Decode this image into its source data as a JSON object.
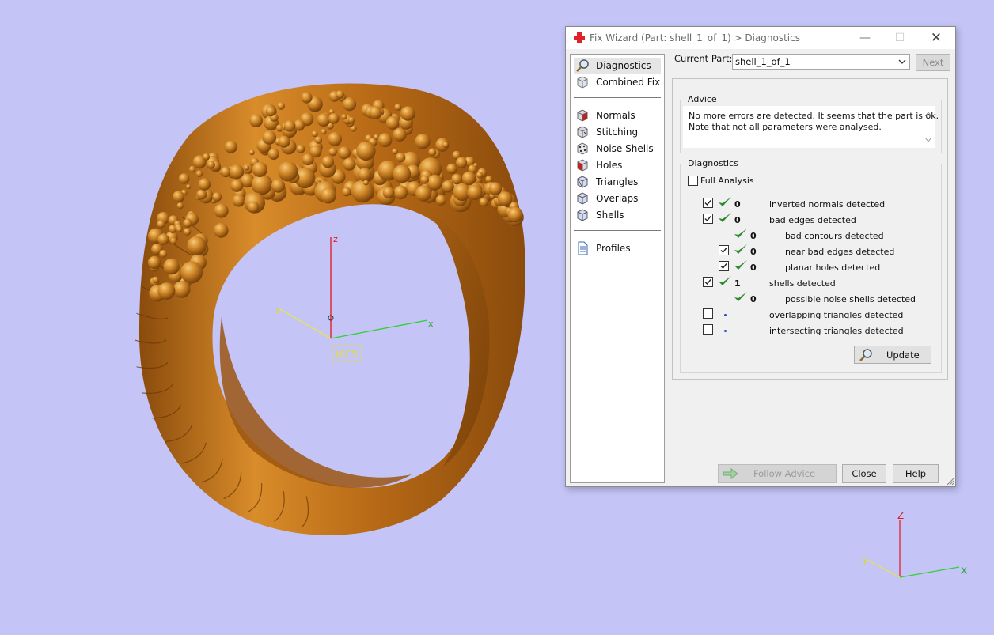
{
  "viewport": {
    "background": "#c4c4f6",
    "wcs_label": "WCS",
    "axis_labels": {
      "x": "x",
      "y": "y",
      "z": "z"
    },
    "corner_axis_labels": {
      "x": "X",
      "y": "Y",
      "z": "Z"
    },
    "model_color": "#c97a1c"
  },
  "dialog": {
    "title": "Fix Wizard (Part: shell_1_of_1) > Diagnostics",
    "icons": {
      "title": "red-cross-icon",
      "min": "minimize-icon",
      "max": "maximize-icon",
      "close": "close-icon"
    },
    "nav": {
      "items": [
        {
          "label": "Diagnostics",
          "icon": "magnifier-icon",
          "selected": true
        },
        {
          "label": "Combined Fix",
          "icon": "cube-icon"
        },
        {
          "label": "Normals",
          "icon": "normals-cube-icon"
        },
        {
          "label": "Stitching",
          "icon": "stitching-cube-icon"
        },
        {
          "label": "Noise Shells",
          "icon": "noise-shells-icon"
        },
        {
          "label": "Holes",
          "icon": "holes-cube-icon"
        },
        {
          "label": "Triangles",
          "icon": "triangles-cube-icon"
        },
        {
          "label": "Overlaps",
          "icon": "overlaps-cube-icon"
        },
        {
          "label": "Shells",
          "icon": "shells-cube-icon"
        },
        {
          "label": "Profiles",
          "icon": "document-icon"
        }
      ]
    },
    "current_part": {
      "label": "Current Part:",
      "value": "shell_1_of_1"
    },
    "next_label": "Next",
    "advice": {
      "title": "Advice",
      "line1": "No more errors are detected. It seems that the part is ok.",
      "line2": "Note that not all parameters were analysed."
    },
    "diagnostics": {
      "title": "Diagnostics",
      "full_analysis": {
        "label": "Full Analysis",
        "checked": false
      },
      "rows": [
        {
          "checked": true,
          "status": "ok",
          "count": "0",
          "label": "inverted normals detected"
        },
        {
          "checked": true,
          "status": "ok",
          "count": "0",
          "label": "bad edges detected"
        },
        {
          "checked": null,
          "status": "ok",
          "count": "0",
          "label": "bad contours detected"
        },
        {
          "checked": true,
          "status": "ok",
          "count": "0",
          "label": "near bad edges detected"
        },
        {
          "checked": true,
          "status": "ok",
          "count": "0",
          "label": "planar holes detected"
        },
        {
          "checked": true,
          "status": "ok",
          "count": "1",
          "label": "shells detected"
        },
        {
          "checked": null,
          "status": "ok",
          "count": "0",
          "label": "possible noise shells detected"
        },
        {
          "checked": false,
          "status": "pending",
          "count": "",
          "label": "overlapping triangles detected"
        },
        {
          "checked": false,
          "status": "pending",
          "count": "",
          "label": "intersecting triangles detected"
        }
      ]
    },
    "update_label": "Update",
    "follow_advice_label": "Follow Advice",
    "close_label": "Close",
    "help_label": "Help",
    "check_color": "#2f8a2f"
  }
}
